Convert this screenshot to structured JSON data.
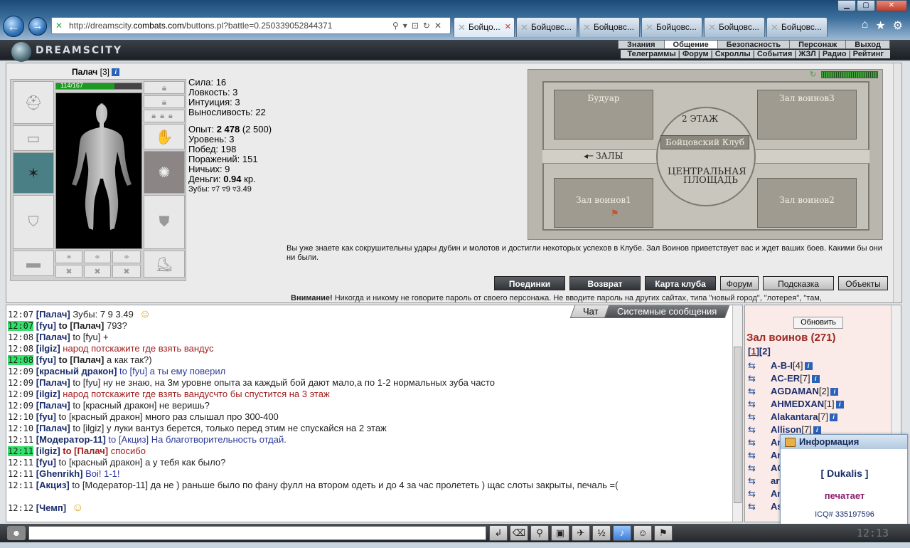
{
  "browser": {
    "url_prefix": "http://dreamscity.",
    "url_domain": "combats.com",
    "url_suffix": "/buttons.pl?battle=0.250339052844371",
    "tabs": [
      "Бойцо...",
      "Бойцовс...",
      "Бойцовс...",
      "Бойцовс...",
      "Бойцовс...",
      "Бойцовс..."
    ],
    "back_glyph": "←",
    "forward_glyph": "→"
  },
  "game": {
    "logo": "DREAMSCITY",
    "menu_top": [
      "Знания",
      "Общение",
      "Безопасность",
      "Персонаж",
      "Выход"
    ],
    "menu_top_selected": 1,
    "menu_sub": [
      "Телеграммы",
      "Форум",
      "Скроллы",
      "События",
      "ЖЗЛ",
      "Радио",
      "Рейтинг"
    ]
  },
  "character": {
    "name": "Палач",
    "level": "[3]",
    "hp": "114/167",
    "hp_fraction": 0.683
  },
  "stats": {
    "sila": "Сила: 16",
    "lovkost": "Ловкость: 3",
    "intuit": "Интуиция: 3",
    "vynos": "Выносливость: 22",
    "opyt_label": "Опыт: ",
    "opyt_val": "2 478",
    "opyt_next": " (2 500)",
    "uroven": "Уровень: 3",
    "pobed": "Побед: 198",
    "porazh": "Поражений: 151",
    "nichyh": "Ничьих: 9",
    "dengi_label": "Деньги: ",
    "dengi_val": "0.94",
    "dengi_unit": " кр.",
    "zuby": "Зубы: ▿7 ▿9 ▿3.49"
  },
  "map": {
    "rooms": [
      "Будуар",
      "Зал воинов3",
      "Зал воинов1",
      "Зал воинов2"
    ],
    "floor2": "2 ЭТАЖ",
    "club": "Бойцовский Клуб",
    "halls": "ЗАЛЫ",
    "central": "ЦЕНТРАЛЬНАЯ",
    "square": "ПЛОЩАДЬ"
  },
  "welcome_text": "Вы уже знаете как сокрушительны удары дубин и молотов и достигли некоторых успехов в Клубе. Зал Воинов приветствует вас и ждет ваших боев. Какими бы они ни были.",
  "buttons": {
    "duels": "Поединки",
    "back": "Возврат",
    "club_map": "Карта клуба",
    "forum": "Форум",
    "hint": "Подсказка",
    "objects": "Объекты"
  },
  "warning": {
    "label": "Внимание!",
    "text": " Никогда и никому не говорите пароль от своего персонажа. Не вводите пароль на других сайтах, типа \"новый город\", \"лотерея\", \"там,"
  },
  "chat": {
    "tab_chat": "Чат",
    "tab_system": "Системные сообщения",
    "lines": [
      {
        "time": "12:07",
        "nick": "[Палач]",
        "text": " Зубы: 7 9 3.49",
        "color": "dark",
        "hl": false,
        "private": ""
      },
      {
        "time": "12:07",
        "nick": "[fyu]",
        "text": " 793?",
        "color": "dark",
        "hl": true,
        "private": " to [Палач]"
      },
      {
        "time": "12:08",
        "nick": "[Палач]",
        "text": " to [fyu] +",
        "color": "dark",
        "hl": false,
        "private": ""
      },
      {
        "time": "12:08",
        "nick": "[ilgiz]",
        "text": " народ потскажите где взять вандус",
        "color": "red",
        "hl": false,
        "private": ""
      },
      {
        "time": "12:08",
        "nick": "[fyu]",
        "text": " а как так?)",
        "color": "dark",
        "hl": true,
        "private": " to [Палач]"
      },
      {
        "time": "12:09",
        "nick": "[красный дракон]",
        "text": " to [fyu] а ты ему поверил",
        "color": "blue",
        "hl": false,
        "private": ""
      },
      {
        "time": "12:09",
        "nick": "[Палач]",
        "text": " to [fyu] ну не знаю, на 3м уровне опыта за каждый бой дают мало,а по 1-2 нормальных зуба часто",
        "color": "dark",
        "hl": false,
        "private": ""
      },
      {
        "time": "12:09",
        "nick": "[ilgiz]",
        "text": " народ потскажите где взять вандусчто бы спустится на 3 этаж",
        "color": "red",
        "hl": false,
        "private": ""
      },
      {
        "time": "12:09",
        "nick": "[Палач]",
        "text": " to [красный дракон] не веришь?",
        "color": "dark",
        "hl": false,
        "private": ""
      },
      {
        "time": "12:10",
        "nick": "[fyu]",
        "text": " to [красный дракон] много раз слышал про 300-400",
        "color": "dark",
        "hl": false,
        "private": ""
      },
      {
        "time": "12:10",
        "nick": "[Палач]",
        "text": " to [ilgiz] у луки вантуз берется, только перед этим не спускайся на 2 этаж",
        "color": "dark",
        "hl": false,
        "private": ""
      },
      {
        "time": "12:11",
        "nick": "[Модератор-11]",
        "text": " to [Акциз] На благотворительность отдай.",
        "color": "blue",
        "hl": false,
        "private": ""
      },
      {
        "time": "12:11",
        "nick": "[ilgiz]",
        "text": " спосибо",
        "color": "red",
        "hl": true,
        "private": " to [Палач]"
      },
      {
        "time": "12:11",
        "nick": "[fyu]",
        "text": " to [красный дракон] а у тебя как было?",
        "color": "dark",
        "hl": false,
        "private": ""
      },
      {
        "time": "12:11",
        "nick": "[Ghenrikh]",
        "text": " Boi! 1-1!",
        "color": "blue",
        "hl": false,
        "private": ""
      },
      {
        "time": "12:11",
        "nick": "[Акциз]",
        "text": " to [Модератор-11] да не ) раньше было по фану фулл на втором одеть и до 4 за час пролететь ) щас слоты закрыты, печаль =(",
        "color": "dark",
        "hl": false,
        "private": ""
      },
      {
        "time": "",
        "nick": "",
        "text": "",
        "color": "dark",
        "hl": false,
        "private": ""
      },
      {
        "time": "12:12",
        "nick": "[Чемп]",
        "text": "",
        "color": "dark",
        "hl": false,
        "private": ""
      }
    ]
  },
  "online": {
    "refresh": "Обновить",
    "room_title": "Зал воинов (271)",
    "page_1": "1",
    "page_2": "2",
    "users": [
      {
        "name": "A-B-I",
        "level": "[4]"
      },
      {
        "name": "AC-ER",
        "level": "[7]"
      },
      {
        "name": "AGDAMAN",
        "level": "[2]"
      },
      {
        "name": "AHMEDXAN",
        "level": "[1]"
      },
      {
        "name": "Alakantara",
        "level": "[7]"
      },
      {
        "name": "Allison",
        "level": "[7]"
      },
      {
        "name": "An",
        "level": ""
      },
      {
        "name": "Ancient Hero",
        "level": "[6]"
      },
      {
        "name": "AQU",
        "level": "[4]"
      },
      {
        "name": "artellogen",
        "level": "[5]"
      },
      {
        "name": "Ankiles-Bk",
        "level": ""
      },
      {
        "name": "Asanny",
        "level": "[3]"
      }
    ]
  },
  "popup": {
    "title": "Информация",
    "name": "[ Dukalis ]",
    "typing": "печатает",
    "icq": "ICQ# 335197596"
  },
  "bottom": {
    "clock": "12:13",
    "tools": [
      "↲",
      "⌫",
      "⚲",
      "▣",
      "✈",
      "½",
      "♪",
      "☺",
      "⚑"
    ]
  }
}
